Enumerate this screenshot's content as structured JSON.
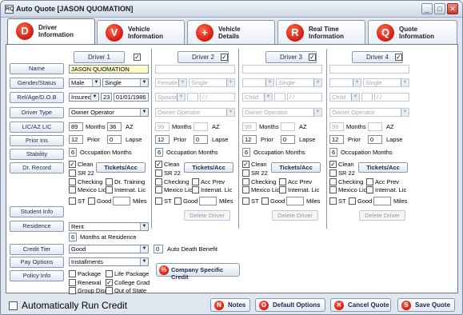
{
  "window": {
    "title": "Auto Quote [JASON QUOMATION]",
    "icon_text": "RQ"
  },
  "tabs": [
    {
      "letter": "D",
      "label": "Driver\nInformation"
    },
    {
      "letter": "V",
      "label": "Vehicle\nInformation"
    },
    {
      "letter": "+",
      "label": "Vehicle\nDetails"
    },
    {
      "letter": "R",
      "label": "Real Time\nInformation"
    },
    {
      "letter": "Q",
      "label": "Quote\nInformation"
    }
  ],
  "left_buttons": [
    "Name",
    "Gender/Status",
    "Rel/Age/D.O.B",
    "Driver Type",
    "LIC/AZ LIC",
    "Prior Ins",
    "Stability",
    "Dr. Record",
    "Student Info",
    "Residence",
    "Credit Tier",
    "Pay Options",
    "Policy Info"
  ],
  "drivers": [
    {
      "header": "Driver 1",
      "name": "JASON QUOMATION",
      "gender": "Male",
      "status": "Single",
      "relation": "Insured",
      "age": "23",
      "dob": "01/01/1986",
      "type": "Owner Operator",
      "months": "89",
      "months_label": "Months",
      "az": "36",
      "az_label": "AZ",
      "prior": "12",
      "prior_label": "Prior",
      "lapse": "0",
      "lapse_label": "Lapse",
      "occ": "6",
      "occ_label": "Occupation Months",
      "clean": "Clean",
      "sr22": "SR 22",
      "tickets": "Tickets/Acc",
      "checking": "Checking",
      "opt2": "Dr. Training",
      "mexico": "Mexico Lic",
      "opt4": "Internat. Lic",
      "st": "ST",
      "good": "Good",
      "miles": "Miles"
    },
    {
      "header": "Driver 2",
      "gender": "Female",
      "status": "Single",
      "relation": "Spouse",
      "dob": "/ /",
      "type": "Owner Operator",
      "months": "99",
      "months_label": "Months",
      "az_label": "AZ",
      "prior": "12",
      "prior_label": "Prior",
      "lapse": "0",
      "lapse_label": "Lapse",
      "occ": "6",
      "occ_label": "Occupation Months",
      "clean": "Clean",
      "sr22": "SR 22",
      "tickets": "Tickets/Acc",
      "checking": "Checking",
      "opt2": "Acc Prev",
      "mexico": "Mexico Lic",
      "opt4": "Internat. Lic",
      "st": "ST",
      "good": "Good",
      "miles": "Miles",
      "delete": "Delete Driver"
    },
    {
      "header": "Driver 3",
      "status": "Single",
      "relation": "Child",
      "dob": "/ /",
      "type": "Owner Operator",
      "months": "99",
      "months_label": "Months",
      "az_label": "AZ",
      "prior": "12",
      "prior_label": "Prior",
      "lapse": "0",
      "lapse_label": "Lapse",
      "occ": "6",
      "occ_label": "Occupation Months",
      "clean": "Clean",
      "sr22": "SR 22",
      "tickets": "Tickets/Acc",
      "checking": "Checking",
      "opt2": "Acc Prev",
      "mexico": "Mexico Lic",
      "opt4": "Internat. Lic",
      "st": "ST",
      "good": "Good",
      "miles": "Miles",
      "delete": "Delete Driver"
    },
    {
      "header": "Driver 4",
      "status": "Single",
      "relation": "Child",
      "dob": "/ /",
      "type": "Owner Operator",
      "months": "99",
      "months_label": "Months",
      "az_label": "AZ",
      "prior": "12",
      "prior_label": "Prior",
      "lapse": "0",
      "lapse_label": "Lapse",
      "occ": "6",
      "occ_label": "Occupation Months",
      "clean": "Clean",
      "sr22": "SR 22",
      "tickets": "Tickets/Acc",
      "checking": "Checking",
      "opt2": "Acc Prev",
      "mexico": "Mexico Lic",
      "opt4": "Internat. Lic",
      "st": "ST",
      "good": "Good",
      "miles": "Miles",
      "delete": "Delete Driver"
    }
  ],
  "residence": {
    "value": "Rent",
    "months": "6",
    "months_label": "Months at Residence"
  },
  "credit_tier": "Good",
  "pay_option": "Installments",
  "policy": {
    "package": "Package",
    "life": "Life Package",
    "renewal": "Renewal",
    "college": "College Grad",
    "group": "Group Disc",
    "out_state": "Out of State"
  },
  "death_benefit": {
    "value": "0",
    "label": "Auto Death Benefit"
  },
  "company_credit": "Company Specific Credit",
  "bottom": {
    "auto_credit": "Automatically Run Credit",
    "notes": "Notes",
    "default_options": "Default Options",
    "cancel": "Cancel Quote",
    "save": "Save Quote"
  }
}
